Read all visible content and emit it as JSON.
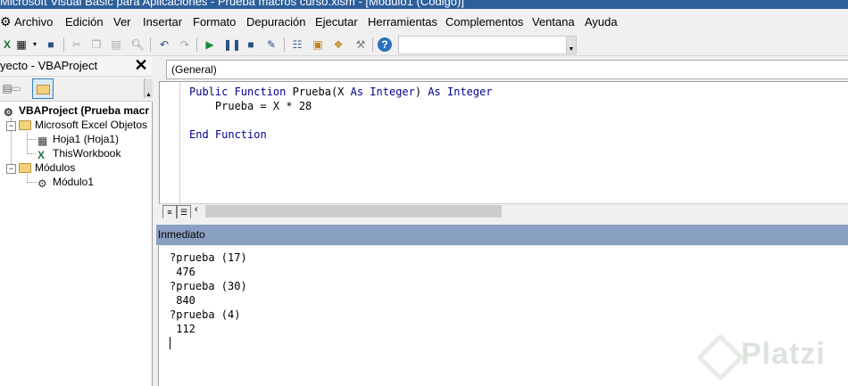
{
  "window": {
    "title": "Microsoft Visual Basic para Aplicaciones - Prueba macros curso.xlsm - [Módulo1 (Código)]"
  },
  "menu": {
    "items": [
      "Archivo",
      "Edición",
      "Ver",
      "Insertar",
      "Formato",
      "Depuración",
      "Ejecutar",
      "Herramientas",
      "Complementos",
      "Ventana",
      "Ayuda"
    ]
  },
  "toolbar": {
    "icons": [
      "excel-icon",
      "insert-userform-icon",
      "save-icon",
      "cut-icon",
      "copy-icon",
      "paste-icon",
      "find-icon",
      "undo-icon",
      "redo-icon",
      "run-icon",
      "break-icon",
      "reset-icon",
      "design-mode-icon",
      "project-explorer-icon",
      "properties-icon",
      "object-browser-icon",
      "toolbox-icon",
      "help-icon"
    ]
  },
  "project": {
    "title": "yecto - VBAProject",
    "close_label": "✕",
    "root": "VBAProject (Prueba macr",
    "excel_objects_folder": "Microsoft Excel Objetos",
    "sheet1": "Hoja1 (Hoja1)",
    "workbook": "ThisWorkbook",
    "modules_folder": "Módulos",
    "module1": "Módulo1"
  },
  "code": {
    "object_combo": "(General)",
    "line1_kw1": "Public Function",
    "line1_mid": " Prueba(X ",
    "line1_kw2": "As Integer",
    "line1_mid2": ") ",
    "line1_kw3": "As Integer",
    "line2": "    Prueba = X * 28",
    "line3_kw": "End Function"
  },
  "immediate": {
    "title": "Inmediato",
    "lines": [
      "?prueba (17)",
      " 476",
      "?prueba (30)",
      " 840",
      "?prueba (4)",
      " 112"
    ]
  },
  "watermark": {
    "text": "Platzi"
  }
}
